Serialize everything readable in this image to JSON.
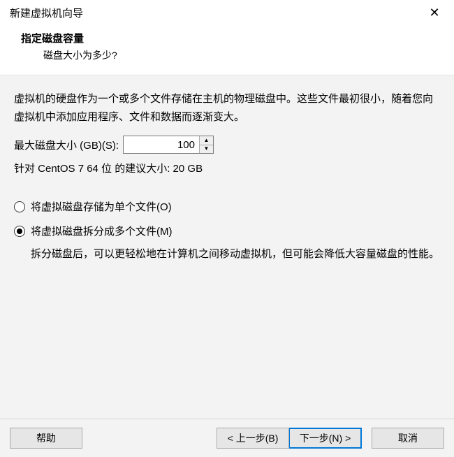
{
  "window": {
    "title": "新建虚拟机向导"
  },
  "header": {
    "subtitle": "指定磁盘容量",
    "question": "磁盘大小为多少?"
  },
  "content": {
    "description": "虚拟机的硬盘作为一个或多个文件存储在主机的物理磁盘中。这些文件最初很小，随着您向虚拟机中添加应用程序、文件和数据而逐渐变大。",
    "max_size_label": "最大磁盘大小 (GB)(S):",
    "max_size_value": "100",
    "recommend": "针对 CentOS 7 64 位 的建议大小: 20 GB",
    "radio_single": "将虚拟磁盘存储为单个文件(O)",
    "radio_split": "将虚拟磁盘拆分成多个文件(M)",
    "split_help": "拆分磁盘后，可以更轻松地在计算机之间移动虚拟机，但可能会降低大容量磁盘的性能。"
  },
  "buttons": {
    "help": "帮助",
    "back": "< 上一步(B)",
    "next": "下一步(N) >",
    "cancel": "取消"
  }
}
